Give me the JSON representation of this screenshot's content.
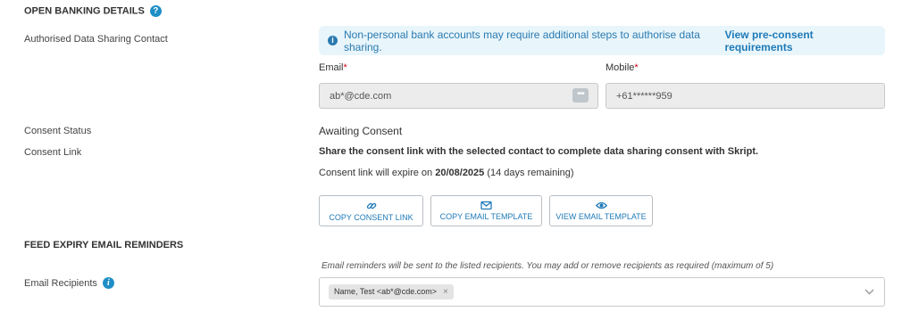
{
  "open_banking": {
    "title": "OPEN BANKING DETAILS",
    "help_icon": "question-circle-icon"
  },
  "sharing_contact": {
    "label": "Authorised Data Sharing Contact",
    "banner_text": "Non-personal bank accounts may require additional steps to authorise data sharing.",
    "banner_link": "View pre-consent requirements",
    "email_label": "Email",
    "email_required": "*",
    "email_value": "ab*@cde.com",
    "email_button": "•••",
    "mobile_label": "Mobile",
    "mobile_required": "*",
    "mobile_value": "+61******959"
  },
  "consent_status": {
    "label": "Consent Status",
    "value": "Awaiting Consent"
  },
  "consent_link": {
    "label": "Consent Link",
    "instruction": "Share the consent link with the selected contact to complete data sharing consent with Skript.",
    "expiry_prefix": "Consent link will expire on ",
    "expiry_date": "20/08/2025",
    "expiry_suffix": " (14 days remaining)",
    "buttons": {
      "copy_link": "COPY CONSENT LINK",
      "copy_email": "COPY EMAIL TEMPLATE",
      "view_email": "VIEW EMAIL TEMPLATE"
    }
  },
  "feed_expiry": {
    "title": "FEED EXPIRY EMAIL REMINDERS",
    "note": "Email reminders will be sent to the listed recipients. You may add or remove recipients as required (maximum of 5)",
    "recipients_label": "Email Recipients",
    "recipient_chip": "Name, Test <ab*@cde.com>",
    "chip_remove": "×"
  },
  "colors": {
    "accent": "#1e7ab8",
    "banner_bg": "#e8f5fb",
    "required": "#d0021b"
  }
}
